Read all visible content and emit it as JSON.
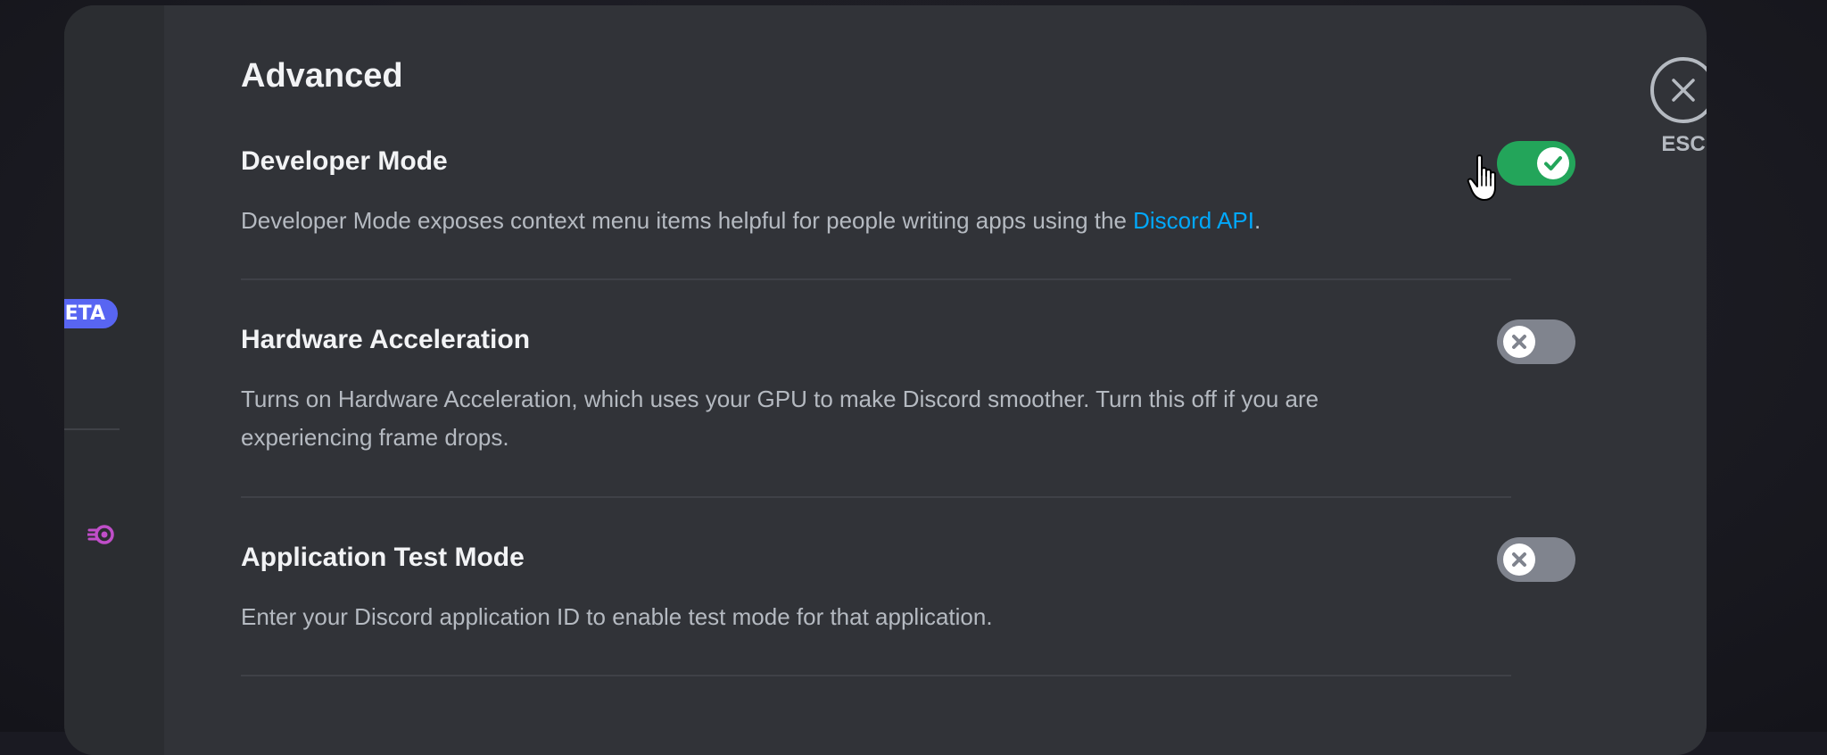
{
  "sidebar": {
    "badge_text": "ETA",
    "nitro_icon": "nitro-icon"
  },
  "page": {
    "title": "Advanced"
  },
  "close": {
    "icon": "close-icon",
    "label": "ESC"
  },
  "settings": [
    {
      "title": "Developer Mode",
      "description": "Developer Mode exposes context menu items helpful for people writing apps using the ",
      "link_text": "Discord API",
      "description_suffix": ".",
      "enabled": true
    },
    {
      "title": "Hardware Acceleration",
      "description": "Turns on Hardware Acceleration, which uses your GPU to make Discord smoother. Turn this off if you are experiencing frame drops.",
      "enabled": false
    },
    {
      "title": "Application Test Mode",
      "description": "Enter your Discord application ID to enable test mode for that application.",
      "enabled": false
    }
  ],
  "colors": {
    "toggle_on": "#23a55a",
    "toggle_off": "#80848e",
    "link": "#00a8fc",
    "beta_badge": "#5865f2"
  }
}
